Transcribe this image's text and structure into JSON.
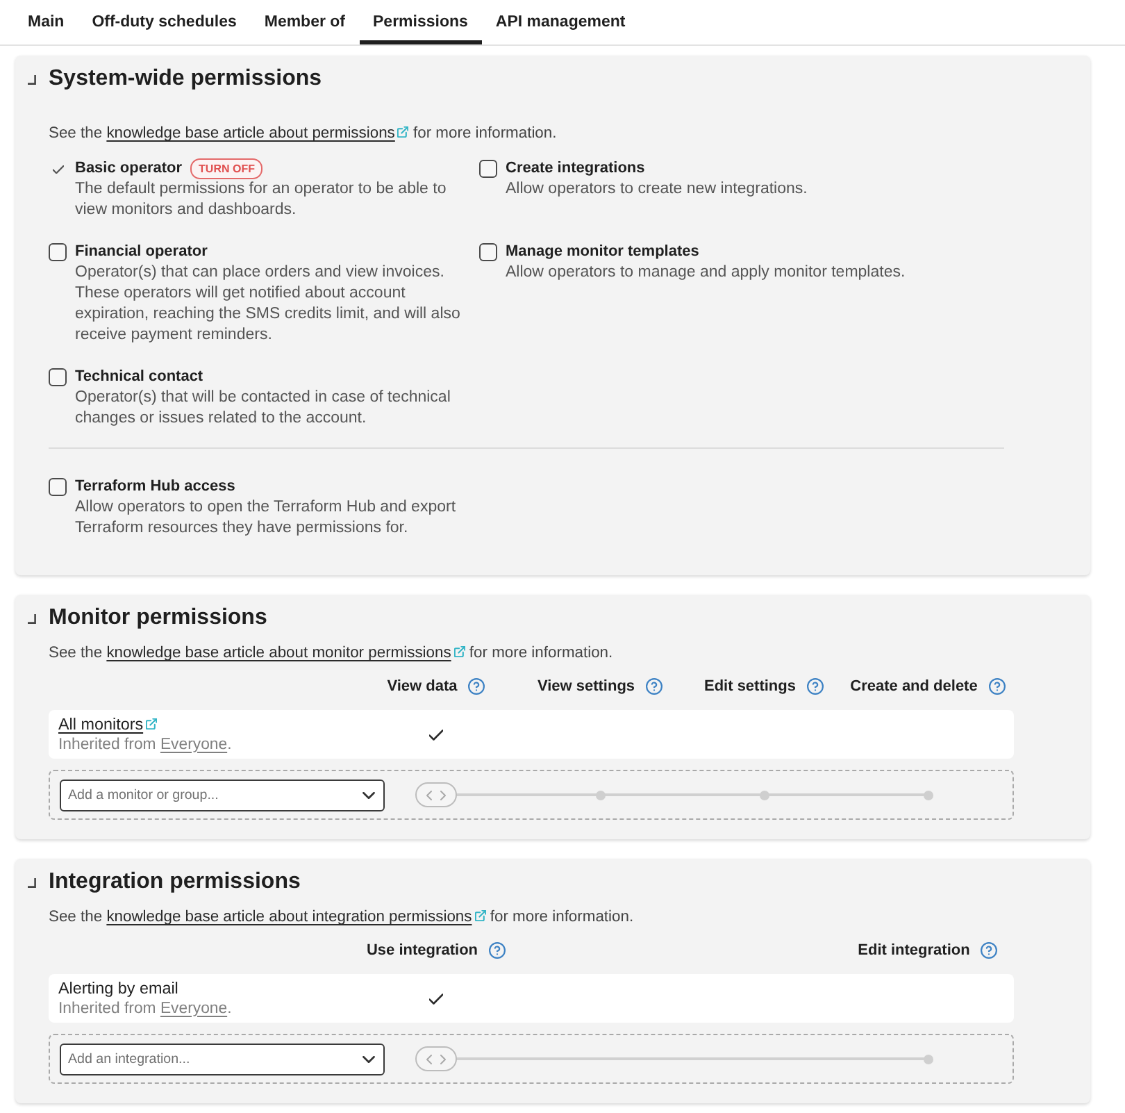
{
  "tabs": [
    {
      "label": "Main",
      "selected": false
    },
    {
      "label": "Off-duty schedules",
      "selected": false
    },
    {
      "label": "Member of",
      "selected": false
    },
    {
      "label": "Permissions",
      "selected": true
    },
    {
      "label": "API management",
      "selected": false
    }
  ],
  "sections": [
    {
      "kind": "checklist",
      "title": "System-wide permissions",
      "note": {
        "prefix": "See the",
        "link": "knowledge base article about permissions",
        "suffix": "for more information."
      },
      "groups": [
        {
          "permissions": [
            {
              "name": "Basic operator",
              "checked": true,
              "action": "TURN OFF",
              "description": "The default permissions for an operator to be able to view monitors and dashboards."
            },
            {
              "name": "Create integrations",
              "checked": false,
              "description": "Allow operators to create new integrations."
            },
            {
              "name": "Financial operator",
              "checked": false,
              "description": "Operator(s) that can place orders and view invoices. These operators will get notified about account expiration, reaching the SMS credits limit, and will also receive payment reminders."
            },
            {
              "name": "Manage monitor templates",
              "checked": false,
              "description": "Allow operators to manage and apply monitor templates."
            },
            {
              "name": "Technical contact",
              "checked": false,
              "description": "Operator(s) that will be contacted in case of technical changes or issues related to the account."
            }
          ]
        },
        {
          "permissions": [
            {
              "name": "Terraform Hub access",
              "checked": false,
              "description": "Allow operators to open the Terraform Hub and export Terraform resources they have permissions for."
            }
          ]
        }
      ]
    },
    {
      "kind": "table",
      "title": "Monitor permissions",
      "note": {
        "prefix": "See the",
        "link": "knowledge base article about monitor permissions",
        "suffix": "for more information."
      },
      "columns": [
        "View data",
        "View settings",
        "Edit settings",
        "Create and delete"
      ],
      "rows": [
        {
          "kind": "link",
          "name": "All monitors",
          "inherited_prefix": "Inherited from",
          "inherited_link": "Everyone",
          "inherited_suffix": ".",
          "cells": [
            {
              "checked": true
            },
            {
              "checked": false
            },
            {
              "checked": false
            },
            {
              "checked": false
            }
          ]
        }
      ],
      "add_row": {
        "placeholder": "Add a monitor or group...",
        "level": 0
      }
    },
    {
      "kind": "table",
      "title": "Integration permissions",
      "note": {
        "prefix": "See the",
        "link": "knowledge base article about integration permissions",
        "suffix": "for more information."
      },
      "columns": [
        "Use integration",
        "Edit integration"
      ],
      "rows": [
        {
          "kind": "plain",
          "name": "Alerting by email",
          "inherited_prefix": "Inherited from",
          "inherited_link": "Everyone",
          "inherited_suffix": ".",
          "cells": [
            {
              "checked": true
            },
            {
              "checked": false
            }
          ]
        }
      ],
      "add_row": {
        "placeholder": "Add an integration...",
        "level": 0
      }
    }
  ]
}
